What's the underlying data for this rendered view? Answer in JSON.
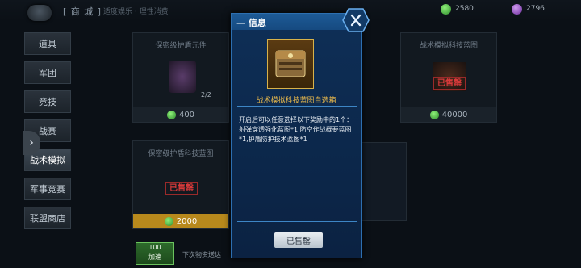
{
  "header": {
    "title": "[ 商 城 ]",
    "subtitle": "适度娱乐 · 理性消费",
    "currencies": [
      {
        "icon": "green-gem-icon",
        "value": "2580"
      },
      {
        "icon": "purple-gem-icon",
        "value": "2796"
      }
    ]
  },
  "menu": {
    "items": [
      {
        "label": "道具"
      },
      {
        "label": "军团"
      },
      {
        "label": "竞技"
      },
      {
        "label": "战赛"
      },
      {
        "label": "战术模拟"
      },
      {
        "label": "军事竞赛"
      },
      {
        "label": "联盟商店"
      }
    ],
    "active_index": 4
  },
  "shop": {
    "cards": [
      {
        "name": "保密级护盾元件",
        "count": "2/2",
        "price": "400"
      },
      {
        "name": "战术模拟科技蓝图",
        "stamp": "已售罄",
        "price": "40000"
      },
      {
        "name": "保密级护盾科技蓝图",
        "stamp": "已售罄",
        "price": "2000"
      }
    ]
  },
  "modal": {
    "title": "信息",
    "item_name": "战术模拟科技蓝图自选箱",
    "description": "开启后可以任意选择以下奖励中的1个：射弹穿透强化蓝图*1,防空作战概要蓝图*1,护盾防护技术蓝图*1",
    "sold_button": "已售罄"
  },
  "bottom": {
    "button_value": "100",
    "button_label": "加速",
    "note": "下次物资送达"
  },
  "colors": {
    "accent": "#2d6fb0",
    "gold": "#b8891c",
    "stamp": "#d63a3a"
  }
}
